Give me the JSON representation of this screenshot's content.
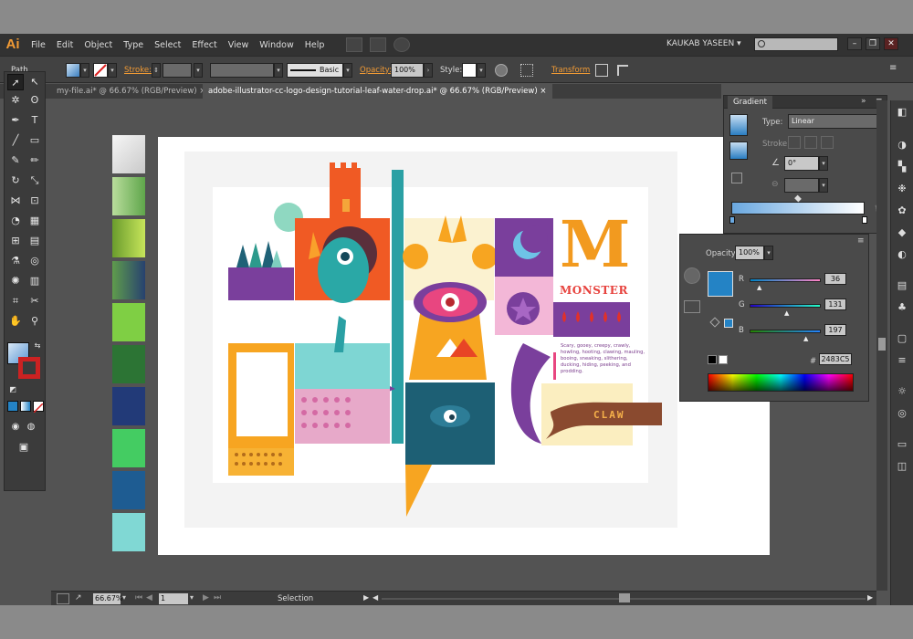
{
  "app": {
    "logo": "Ai"
  },
  "menubar": {
    "items": [
      "File",
      "Edit",
      "Object",
      "Type",
      "Select",
      "Effect",
      "View",
      "Window",
      "Help"
    ],
    "user": "KAUKAB YASEEN",
    "user_arrow": "▾"
  },
  "controlbar": {
    "selection_label": "Path",
    "stroke_label": "Stroke:",
    "brush_label": "Basic",
    "opacity_label": "Opacity:",
    "opacity_value": "100%",
    "style_label": "Style:",
    "transform_label": "Transform"
  },
  "tabs": [
    {
      "label": "my-file.ai* @ 66.67% (RGB/Preview)",
      "close": "×"
    },
    {
      "label": "adobe-illustrator-cc-logo-design-tutorial-leaf-water-drop.ai* @ 66.67% (RGB/Preview)",
      "close": "×"
    }
  ],
  "gradient_panel": {
    "title": "Gradient",
    "type_label": "Type:",
    "type_value": "Linear",
    "stroke_label": "Stroke:",
    "angle_value": "0°"
  },
  "color_panel": {
    "opacity_label": "Opacity:",
    "opacity_value": "100%",
    "r_label": "R",
    "r_value": "36",
    "g_label": "G",
    "g_value": "131",
    "b_label": "B",
    "b_value": "197",
    "hex_label": "#",
    "hex_value": "2483C5"
  },
  "status": {
    "zoom": "66.67%",
    "page": "1",
    "mode": "Selection"
  },
  "artwork": {
    "title_letter": "M",
    "title_word": "MONSTER",
    "description": "Scary, gooey, creepy, crawly, howling, hooting, clawing, mauling, booing, sneaking, slithering, ducking, hiding, peeking, and prodding.",
    "claw": "CLAW"
  },
  "swatches": [
    "#eaeaea",
    "#9fd27e",
    "#8cc63f",
    "#4b7a5a",
    "#7fc241",
    "#2c6e39",
    "#1f3a73",
    "#3fcb5f",
    "#1d5b8e",
    "#7ed7d6"
  ],
  "colors": {
    "accent_orange": "#f29b35",
    "selected_fill": "#2483c5",
    "panel_bg": "#4a4a4a",
    "ui_bg": "#535353"
  }
}
